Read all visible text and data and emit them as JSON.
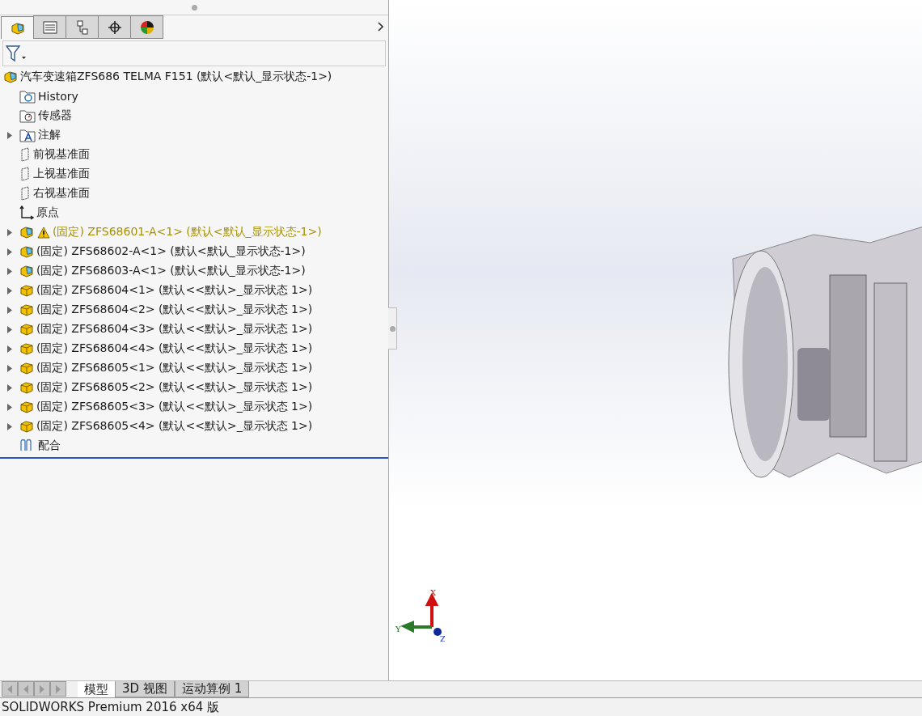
{
  "panel_tabs": [
    {
      "kind": "feature",
      "selected": true
    },
    {
      "kind": "property",
      "selected": false
    },
    {
      "kind": "config",
      "selected": false
    },
    {
      "kind": "dim",
      "selected": false
    },
    {
      "kind": "display",
      "selected": false
    }
  ],
  "tree": {
    "label": "汽车变速箱ZFS686 TELMA F151  (默认<默认_显示状态-1>)",
    "kind": "assembly",
    "children": [
      {
        "label": "History",
        "kind": "history",
        "expandable": false,
        "warning": false
      },
      {
        "label": "传感器",
        "kind": "sensor",
        "expandable": false,
        "warning": false
      },
      {
        "label": "注解",
        "kind": "annotation",
        "expandable": true,
        "warning": false
      },
      {
        "label": "前视基准面",
        "kind": "plane",
        "expandable": false,
        "warning": false
      },
      {
        "label": "上视基准面",
        "kind": "plane",
        "expandable": false,
        "warning": false
      },
      {
        "label": "右视基准面",
        "kind": "plane",
        "expandable": false,
        "warning": false
      },
      {
        "label": "原点",
        "kind": "origin",
        "expandable": false,
        "warning": false
      },
      {
        "label": "(固定) ZFS68601-A<1> (默认<默认_显示状态-1>)",
        "kind": "assembly",
        "expandable": true,
        "warning": true
      },
      {
        "label": "(固定) ZFS68602-A<1> (默认<默认_显示状态-1>)",
        "kind": "assembly",
        "expandable": true,
        "warning": false
      },
      {
        "label": "(固定) ZFS68603-A<1> (默认<默认_显示状态-1>)",
        "kind": "assembly",
        "expandable": true,
        "warning": false
      },
      {
        "label": "(固定) ZFS68604<1> (默认<<默认>_显示状态 1>)",
        "kind": "part",
        "expandable": true,
        "warning": false
      },
      {
        "label": "(固定) ZFS68604<2> (默认<<默认>_显示状态 1>)",
        "kind": "part",
        "expandable": true,
        "warning": false
      },
      {
        "label": "(固定) ZFS68604<3> (默认<<默认>_显示状态 1>)",
        "kind": "part",
        "expandable": true,
        "warning": false
      },
      {
        "label": "(固定) ZFS68604<4> (默认<<默认>_显示状态 1>)",
        "kind": "part",
        "expandable": true,
        "warning": false
      },
      {
        "label": "(固定) ZFS68605<1> (默认<<默认>_显示状态 1>)",
        "kind": "part",
        "expandable": true,
        "warning": false
      },
      {
        "label": "(固定) ZFS68605<2> (默认<<默认>_显示状态 1>)",
        "kind": "part",
        "expandable": true,
        "warning": false
      },
      {
        "label": "(固定) ZFS68605<3> (默认<<默认>_显示状态 1>)",
        "kind": "part",
        "expandable": true,
        "warning": false
      },
      {
        "label": "(固定) ZFS68605<4> (默认<<默认>_显示状态 1>)",
        "kind": "part",
        "expandable": true,
        "warning": false
      },
      {
        "label": "配合",
        "kind": "mates",
        "expandable": false,
        "warning": false
      }
    ]
  },
  "triad": {
    "x": "X",
    "y": "Y",
    "z": "Z"
  },
  "sheet_tabs": [
    {
      "label": "模型",
      "selected": true
    },
    {
      "label": "3D 视图",
      "selected": false
    },
    {
      "label": "运动算例 1",
      "selected": false
    }
  ],
  "status_bar": "SOLIDWORKS Premium 2016 x64 版"
}
